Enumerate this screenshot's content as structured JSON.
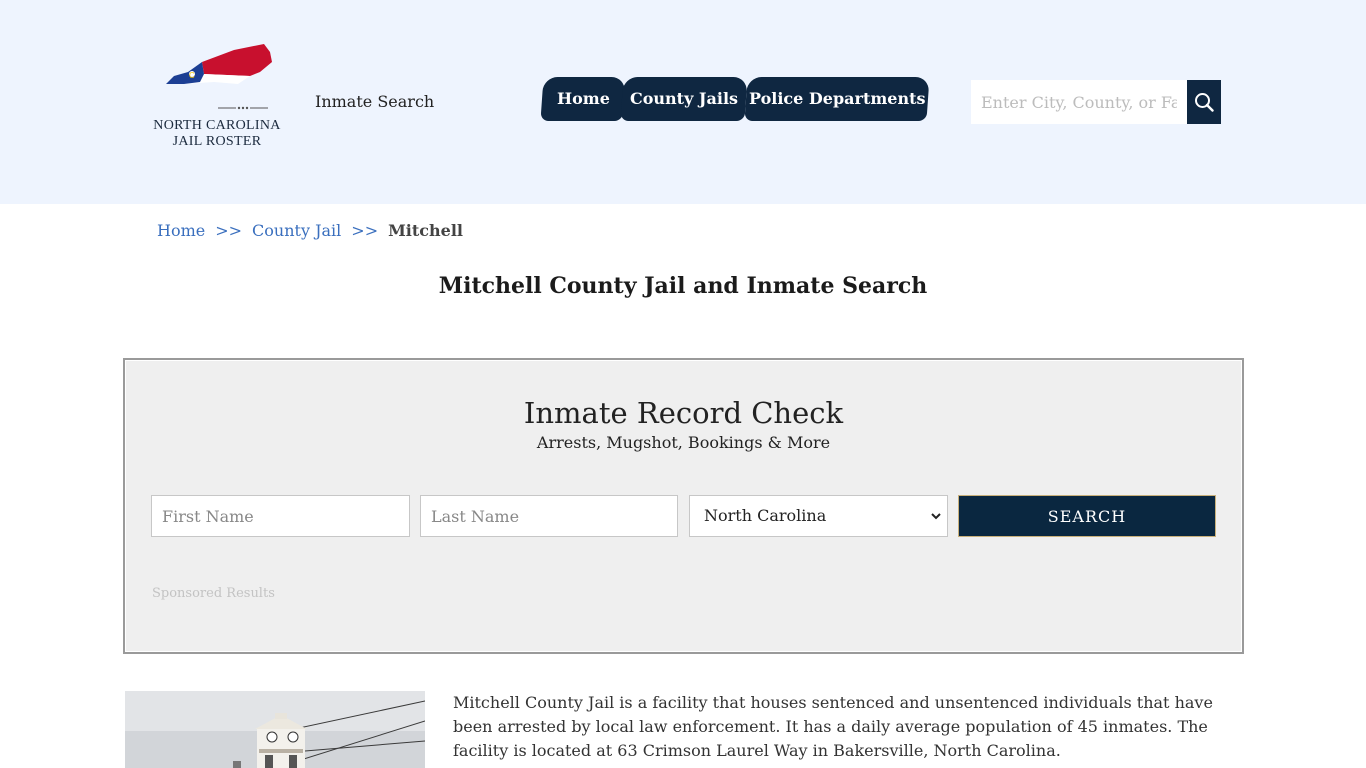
{
  "header": {
    "logo_line1": "NORTH CAROLINA",
    "logo_line2": "JAIL ROSTER",
    "tagline": "Inmate Search",
    "nav": [
      {
        "label": "Home"
      },
      {
        "label": "County Jails"
      },
      {
        "label": "Police Departments"
      }
    ],
    "search_placeholder": "Enter City, County, or Facility",
    "colors": {
      "background": "#eef4fe",
      "nav": "#0f2741"
    }
  },
  "breadcrumb": {
    "home": "Home",
    "separator": ">>",
    "county_jail": "County Jail",
    "current": "Mitchell"
  },
  "page_title": "Mitchell County Jail and Inmate Search",
  "record_check": {
    "title": "Inmate Record Check",
    "subtitle": "Arrests, Mugshot, Bookings & More",
    "first_name_placeholder": "First Name",
    "last_name_placeholder": "Last Name",
    "state_selected": "North Carolina",
    "search_label": "SEARCH",
    "sponsored": "Sponsored Results"
  },
  "content": {
    "description": "Mitchell County Jail is a facility that houses sentenced and unsentenced individuals that have been arrested by local law enforcement. It has a daily average population of 45 inmates. The facility is located at 63 Crimson Laurel Way in Bakersville, North Carolina."
  }
}
